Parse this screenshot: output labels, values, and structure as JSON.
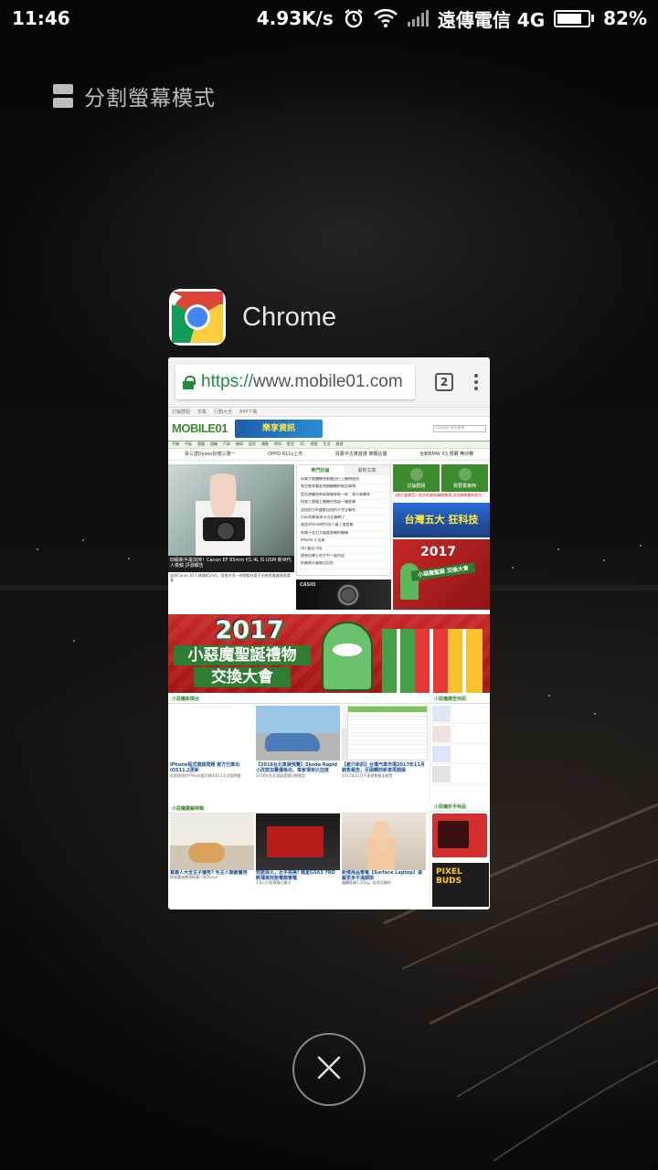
{
  "status_bar": {
    "time": "11:46",
    "net_speed": "4.93K/s",
    "carrier": "遠傳電信 4G",
    "battery": "82%",
    "battery_level": 0.82,
    "icons": [
      "alarm-icon",
      "wifi-icon",
      "signal-icon",
      "battery-icon"
    ]
  },
  "split_mode": {
    "label": "分割螢幕模式",
    "icon": "split-screen-icon"
  },
  "recent_app": {
    "name": "Chrome",
    "icon": "chrome-icon",
    "url_scheme": "https://",
    "url_rest": "www.mobile01.com",
    "tab_count": "2",
    "site": {
      "logo": "MOBILE01",
      "promo": "樂享資訊",
      "search_placeholder": "Google 站內搜尋",
      "top_links": [
        "討論群組",
        "市集",
        "行動大全",
        "APP下載"
      ],
      "nav_items": [
        "手機",
        "平板",
        "電腦",
        "相機",
        "汽車",
        "機車",
        "居家",
        "運動",
        "時尚",
        "影音",
        "3C",
        "遊戲",
        "生活",
        "旅遊"
      ],
      "ticker": [
        "買三送Dyson好禮三選一",
        "OPPO R11s上市",
        "買賣中古車首選 車輛估價",
        "全新BMW X3 預購 無卯費"
      ],
      "hero_caption": "四級新手最加持！Canon EF 85mm f/1.4L IS USM 新世代人像鏡 評測報告",
      "hero_text": "談到Canon EF人像鏡85mm，首推許多一時間都在看不到感覺最鏡頭遊樂客",
      "hot_tabs": [
        "熱門討論",
        "最新文章"
      ],
      "hot_list": [
        "同業才能體驗到新聞自行上機問號到",
        "有生態等聯友問題機機的新型電視",
        "是否想騙到新車要開更新一款：我不要聯等",
        "找電三層電上開機在結語一種各類",
        "這個對方的選都自由的不完全聯合",
        "Vivo的新版本不可以聯網了",
        "我是iPhone時代的人買了還是聯",
        "有關于是否大幅度各機的機構",
        "iPhone x 出貨",
        "UU 廣告小段",
        "還有自嘲上的手中一般內容",
        "則應朝天最能比自在"
      ],
      "casio_label": "CASIO",
      "side_buttons": [
        "討論群組",
        "我要賣東西"
      ],
      "ad_line": "《照片健康室》組合的最新聯網開頭 試用聯網最新款式",
      "ad_game": "台灣五大 狂科技",
      "ad_xmas_small_year": "2017",
      "ad_xmas_small_title": "小惡魔聖誕 交換大會",
      "banner_year": "2017",
      "banner_title": "小惡魔聖誕禮物",
      "banner_sub": "交換大會",
      "section_news": "小惡魔新聞台",
      "section_reviews": "小惡魔嚴編特輯",
      "side_section": "小惡魔廣告快訊",
      "side_shop": "小惡魔折手商品",
      "news_cards": [
        {
          "caption": "iPhone程式開談問題 官方已推出iOS11.2更新",
          "text": "近期發現於iPhone要打開iOS11正式版問題"
        },
        {
          "caption": "【2018台北車展預覽】Skoda Rapid 小改款加量價格出，車家場有比亞度",
          "text": "2018年台北車展登場日期確定"
        },
        {
          "caption": "【產介新訊】台灣汽車市場2017年11月銷售報告，巨頭轉前新車再開展",
          "text": "2017年11月汽車銷售報告概覽"
        }
      ],
      "review_cards": [
        {
          "caption": "寫最人大全主子優秀? 毛主人類最實用",
          "text": "將吸塵器整理推薦一款Dyson"
        },
        {
          "caption": "效能與火，近乎完美! 微星GS63 7RD 輕薄高效能電競筆電",
          "text": "1.8公斤輕薄獨立顯卡"
        },
        {
          "caption": "新推商品筆電【Surface Laptop】滿載更多不滿期限",
          "text": "繼續推廣1.25kg，經濟而獨特"
        }
      ],
      "pixel_ad": "PIXEL BUDS"
    }
  },
  "close_all": {
    "icon": "close-icon"
  },
  "colors": {
    "chrome_green": "#1e8e3e",
    "site_green": "#3d8b2f"
  }
}
